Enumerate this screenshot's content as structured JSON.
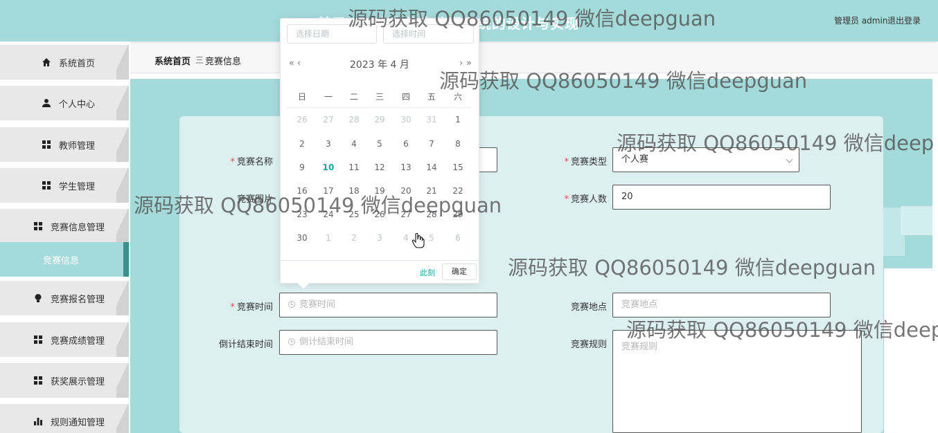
{
  "header": {
    "title": "基于……竞赛信息管理系统的设计与实现",
    "user_label": "管理员 admin",
    "logout_label": "退出登录",
    "bg_color": "#a5dadb"
  },
  "sidebar": {
    "items": [
      {
        "label": "系统首页",
        "icon": "home-icon"
      },
      {
        "label": "个人中心",
        "icon": "user-icon"
      },
      {
        "label": "教师管理",
        "icon": "grid-icon"
      },
      {
        "label": "学生管理",
        "icon": "grid-icon"
      },
      {
        "label": "竞赛信息管理",
        "icon": "grid-icon"
      },
      {
        "label": "竞赛报名管理",
        "icon": "bulb-icon"
      },
      {
        "label": "竞赛成绩管理",
        "icon": "grid-icon"
      },
      {
        "label": "获奖展示管理",
        "icon": "grid-icon"
      },
      {
        "label": "规则通知管理",
        "icon": "bar-chart-icon"
      }
    ],
    "active_sub": "竞赛信息"
  },
  "breadcrumb": {
    "home": "系统首页",
    "separator": "三",
    "current": "竞赛信息"
  },
  "form": {
    "name_label": "竞赛名称",
    "image_label": "竞赛图片",
    "type_label": "竞赛类型",
    "type_value": "个人赛",
    "count_label": "竞赛人数",
    "count_value": "20",
    "time_label": "竞赛时间",
    "time_placeholder": "竞赛时间",
    "countdown_label": "倒计结束时间",
    "countdown_placeholder": "倒计结束时间",
    "place_label": "竞赛地点",
    "place_placeholder": "竞赛地点",
    "rules_label": "竞赛规则",
    "rules_placeholder": "竞赛规则",
    "required_mark": "*"
  },
  "datepicker": {
    "date_placeholder": "选择日期",
    "time_placeholder": "选择时间",
    "prev_year": "«",
    "prev_month": "‹",
    "next_month": "›",
    "next_year": "»",
    "year_month": "2023 年  4 月",
    "weekdays": [
      "日",
      "一",
      "二",
      "三",
      "四",
      "五",
      "六"
    ],
    "weeks": [
      [
        "26",
        "27",
        "28",
        "29",
        "30",
        "31",
        "1"
      ],
      [
        "2",
        "3",
        "4",
        "5",
        "6",
        "7",
        "8"
      ],
      [
        "9",
        "10",
        "11",
        "12",
        "13",
        "14",
        "15"
      ],
      [
        "16",
        "17",
        "18",
        "19",
        "20",
        "21",
        "22"
      ],
      [
        "23",
        "24",
        "25",
        "26",
        "27",
        "28",
        "29"
      ],
      [
        "30",
        "1",
        "2",
        "3",
        "4",
        "5",
        "6"
      ]
    ],
    "today": "10",
    "now_label": "此刻",
    "ok_label": "确定",
    "accent_color": "#1aa89f"
  },
  "watermarks": [
    "源码获取 QQ86050149 微信deepguan",
    "源码获取 QQ86050149 微信deepguan",
    "源码获取 QQ86050149 微信deep",
    "源码获取 QQ86050149 微信deepguan",
    "源码获取 QQ86050149 微信deepguan",
    "源码获取 QQ86050149 微信deep"
  ]
}
